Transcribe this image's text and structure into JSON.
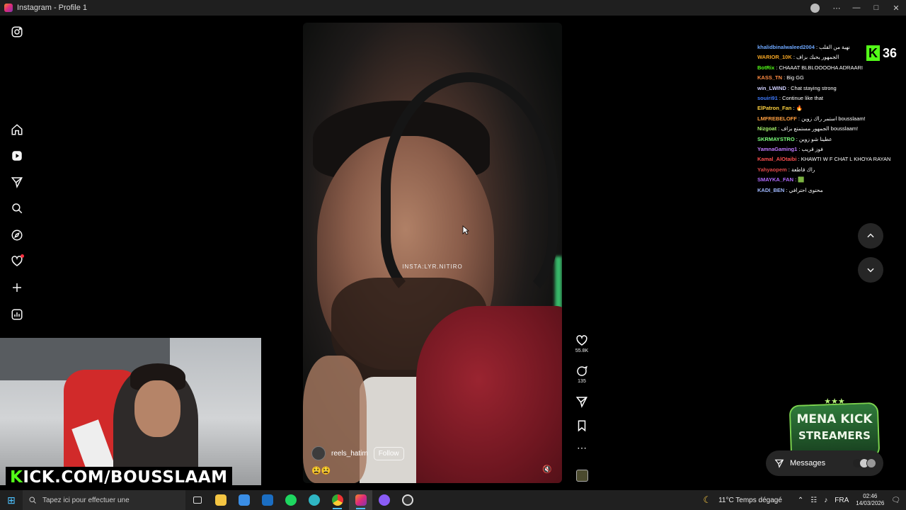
{
  "window": {
    "title": "Instagram - Profile 1",
    "min": "—",
    "max": "□",
    "close": "✕",
    "more": "⋯"
  },
  "sidebar": [
    "instagram-logo",
    "home",
    "reels",
    "messages",
    "search",
    "explore",
    "notifications",
    "create",
    "dashboard"
  ],
  "reel": {
    "watermark": "INSTA:LYR.NITIRO",
    "author": "reels_hatim",
    "follow_label": "Follow",
    "caption": "😫😫",
    "mute_icon": "🔇"
  },
  "actions": {
    "likes": "55.8K",
    "comments": "135",
    "more": "⋯"
  },
  "chat": {
    "messages": [
      {
        "user": "khalidbinalwaleed2004",
        "text": "نهية من القلب",
        "color": "#6ea8ff"
      },
      {
        "user": "WARIOR_10K",
        "text": "الجمهور يحبك بزاف",
        "color": "#f5a623"
      },
      {
        "user": "BotRix",
        "text": "CHAAAT BLBLOOOOHA ADRAARI",
        "color": "#53fc18"
      },
      {
        "user": "KASS_TN",
        "text": "Big GG",
        "color": "#ff8c42"
      },
      {
        "user": "win_LWIND",
        "text": "Chat staying strong",
        "color": "#d0d0ff"
      },
      {
        "user": "souiri91",
        "text": "Continue like that",
        "color": "#3f7bff"
      },
      {
        "user": "ElPatron_Fan",
        "text": "🔥",
        "color": "#ffd23f"
      },
      {
        "user": "LMFREBELOFF",
        "text": "استمر راك زوين bousslaam!",
        "color": "#ff9f40"
      },
      {
        "user": "Nizgoat",
        "text": "الجمهور مستمتع بزاف bousslaam!",
        "color": "#a4f06a"
      },
      {
        "user": "SKRMAYSTRO",
        "text": "عطينا شو زوين",
        "color": "#7dff7d"
      },
      {
        "user": "YamnaGaming1",
        "text": "فوز قريب",
        "color": "#c07bff"
      },
      {
        "user": "Kamal_AlOtaibi",
        "text": "KHAWTI W F CHAT L KHOYA RAYAN",
        "color": "#ff4f4f"
      },
      {
        "user": "Yahyaopem",
        "text": "راك قاطعة",
        "color": "#e04848"
      },
      {
        "user": "SMAYKA_FAN",
        "text": "🟩",
        "color": "#b06bff"
      },
      {
        "user": "KADI_BEN",
        "text": "محتوى احترافي",
        "color": "#9fb8ff"
      }
    ]
  },
  "kick": {
    "logo": "K",
    "viewers": "36"
  },
  "mena": {
    "line1": "MENA KICK",
    "line2": "STREAMERS",
    "stars": "★★★"
  },
  "messages_pill": {
    "label": "Messages"
  },
  "webcam_banner": {
    "k": "K",
    "rest": "ICK.COM/BOUSSLAAM"
  },
  "taskbar": {
    "search_placeholder": "Tapez ici pour effectuer une",
    "weather": "11°C  Temps dégagé",
    "lang": "FRA",
    "time": "02:46",
    "date": "14/03/2026"
  }
}
